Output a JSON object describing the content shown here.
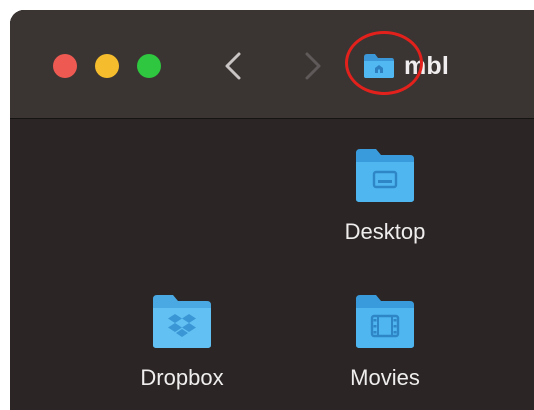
{
  "window": {
    "title": "mbl",
    "title_icon": "home-folder-icon"
  },
  "toolbar": {
    "back_icon": "chevron-left-icon",
    "forward_icon": "chevron-right-icon"
  },
  "traffic_lights": {
    "close_color": "#ee5a52",
    "minimize_color": "#f5bd2d",
    "zoom_color": "#2ec73f"
  },
  "annotation": {
    "color": "#e2211c",
    "target": "title-folder-icon"
  },
  "folder_color": "#44b0ec",
  "items": [
    {
      "label": "Desktop",
      "icon": "desktop-folder-icon"
    },
    {
      "label": "Dropbox",
      "icon": "dropbox-folder-icon"
    },
    {
      "label": "Movies",
      "icon": "movies-folder-icon"
    }
  ]
}
